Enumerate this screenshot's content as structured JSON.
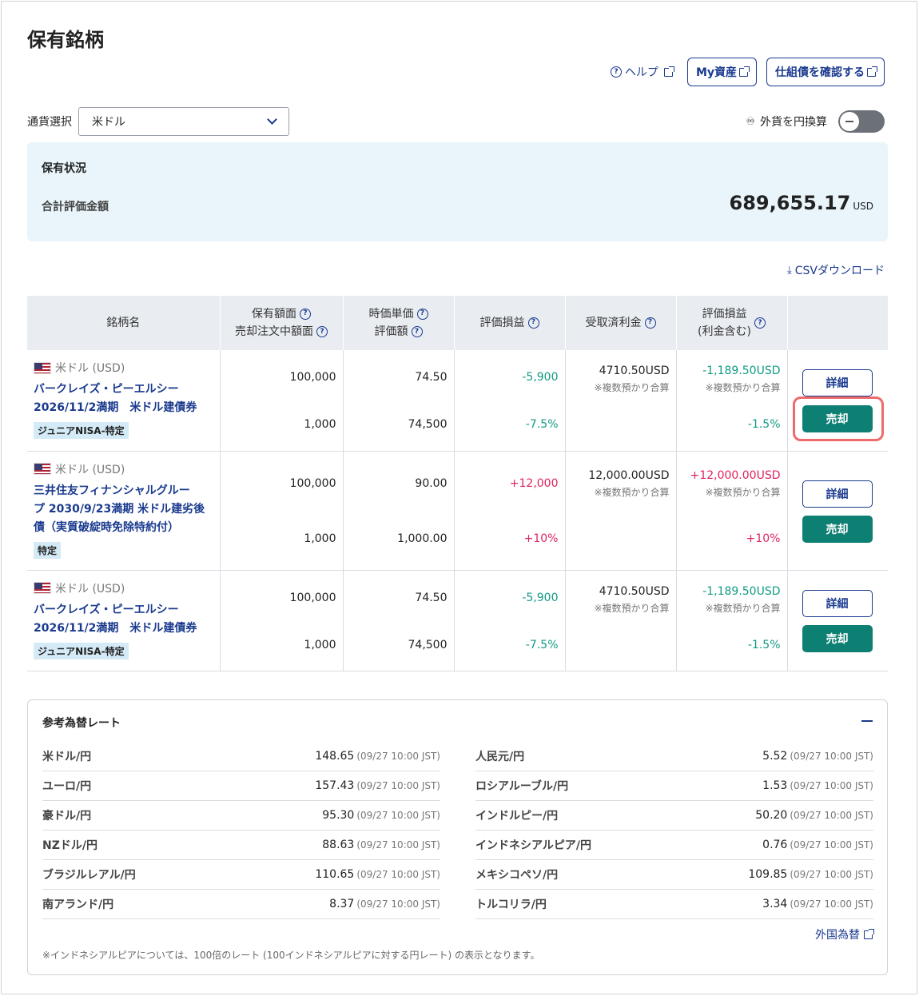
{
  "page": {
    "title": "保有銘柄"
  },
  "header_links": {
    "help": "ヘルプ",
    "my_assets": "My資産",
    "check_bonds": "仕組債を確認する"
  },
  "currency": {
    "label": "通貨選択",
    "selected": "米ドル"
  },
  "convert": {
    "label": "外貨を円換算",
    "enabled": false
  },
  "summary": {
    "title": "保有状況",
    "total_label": "合計評価金額",
    "total_value": "689,655.17",
    "unit": "USD"
  },
  "csv_download": "CSVダウンロード",
  "table": {
    "headers": {
      "name": "銘柄名",
      "holding": "保有額面",
      "sell_order": "売却注文中額面",
      "unit_price": "時価単価",
      "valuation": "評価額",
      "gain": "評価損益",
      "received": "受取済利金",
      "gain_incl_1": "評価損益",
      "gain_incl_2": "(利金含む)"
    },
    "rows": [
      {
        "currency": "米ドル (USD)",
        "name_lines": [
          "バークレイズ・ピーエルシー",
          "2026/11/2満期　米ドル建債券"
        ],
        "tag": "ジュニアNISA-特定",
        "holding": "100,000",
        "sell_order": "1,000",
        "unit_price": "74.50",
        "valuation": "74,500",
        "gain": "-5,900",
        "gain_pct": "-7.5%",
        "received": "4710.50USD",
        "received_note": "※複数預かり合算",
        "gain_incl": "-1,189.50USD",
        "gain_incl_note": "※複数預かり合算",
        "gain_incl_pct": "-1.5%",
        "detail": "詳細",
        "sell": "売却"
      },
      {
        "currency": "米ドル (USD)",
        "name_lines": [
          "三井住友フィナンシャルグルー",
          "プ 2030/9/23満期 米ドル建劣後",
          "債（実質破綻時免除特約付）"
        ],
        "tag": "特定",
        "holding": "100,000",
        "sell_order": "1,000",
        "unit_price": "90.00",
        "valuation": "1,000.00",
        "gain": "+12,000",
        "gain_pct": "+10%",
        "received": "12,000.00USD",
        "received_note": "※複数預かり合算",
        "gain_incl": "+12,000.00USD",
        "gain_incl_note": "※複数預かり合算",
        "gain_incl_pct": "+10%",
        "detail": "詳細",
        "sell": "売却"
      },
      {
        "currency": "米ドル (USD)",
        "name_lines": [
          "バークレイズ・ピーエルシー",
          "2026/11/2満期　米ドル建債券"
        ],
        "tag": "ジュニアNISA-特定",
        "holding": "100,000",
        "sell_order": "1,000",
        "unit_price": "74.50",
        "valuation": "74,500",
        "gain": "-5,900",
        "gain_pct": "-7.5%",
        "received": "4710.50USD",
        "received_note": "※複数預かり合算",
        "gain_incl": "-1,189.50USD",
        "gain_incl_note": "※複数預かり合算",
        "gain_incl_pct": "-1.5%",
        "detail": "詳細",
        "sell": "売却"
      }
    ]
  },
  "rates": {
    "title": "参考為替レート",
    "left": [
      {
        "name": "米ドル/円",
        "value": "148.65",
        "time": "(09/27 10:00 JST)"
      },
      {
        "name": "ユーロ/円",
        "value": "157.43",
        "time": "(09/27 10:00 JST)"
      },
      {
        "name": "豪ドル/円",
        "value": "95.30",
        "time": "(09/27 10:00 JST)"
      },
      {
        "name": "NZドル/円",
        "value": "88.63",
        "time": "(09/27 10:00 JST)"
      },
      {
        "name": "ブラジルレアル/円",
        "value": "110.65",
        "time": "(09/27 10:00 JST)"
      },
      {
        "name": "南アランド/円",
        "value": "8.37",
        "time": "(09/27 10:00 JST)"
      }
    ],
    "right": [
      {
        "name": "人民元/円",
        "value": "5.52",
        "time": "(09/27 10:00 JST)"
      },
      {
        "name": "ロシアルーブル/円",
        "value": "1.53",
        "time": "(09/27 10:00 JST)"
      },
      {
        "name": "インドルピー/円",
        "value": "50.20",
        "time": "(09/27 10:00 JST)"
      },
      {
        "name": "インドネシアルピア/円",
        "value": "0.76",
        "time": "(09/27 10:00 JST)"
      },
      {
        "name": "メキシコペソ/円",
        "value": "109.85",
        "time": "(09/27 10:00 JST)"
      },
      {
        "name": "トルコリラ/円",
        "value": "3.34",
        "time": "(09/27 10:00 JST)"
      }
    ],
    "fx_link": "外国為替",
    "note": "※インドネシアルピアについては、100倍のレート (100インドネシアルピアに対する円レート) の表示となります。"
  },
  "colors": {
    "brand": "#1a3a8f",
    "sell_button": "#0d7f73",
    "negative": "#129a85",
    "positive": "#e0245e",
    "summary_bg": "#e9f5fb",
    "highlight": "#ee6b6b"
  }
}
